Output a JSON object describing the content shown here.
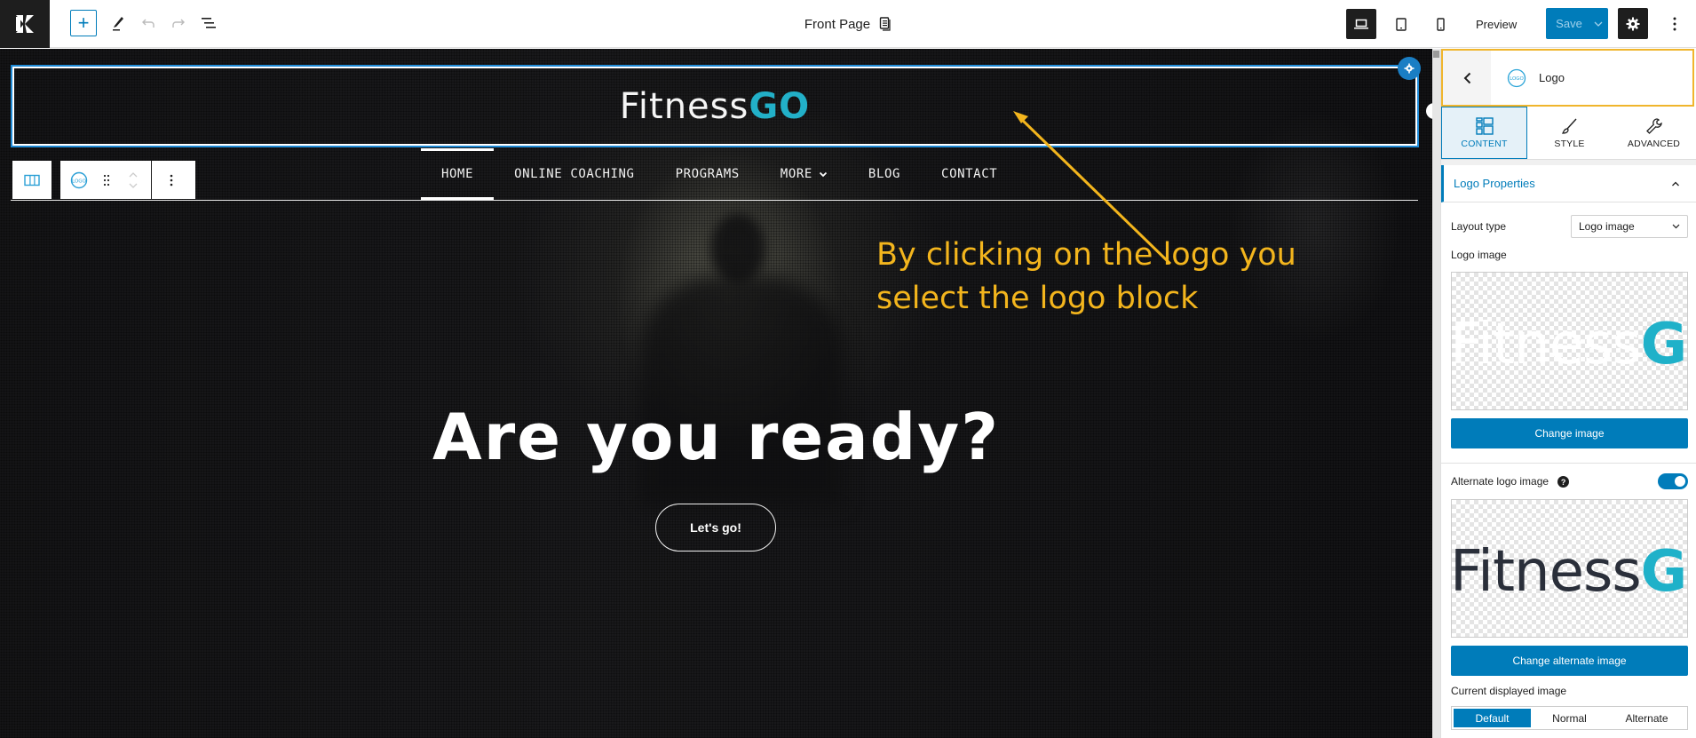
{
  "topbar": {
    "document_title": "Front Page",
    "preview_label": "Preview",
    "save_label": "Save",
    "icons": {
      "site": "kadence-logo-icon",
      "inserter": "plus-icon",
      "tools": "pencil-icon",
      "undo": "undo-icon",
      "redo": "redo-icon",
      "list_view": "list-view-icon",
      "document": "document-icon",
      "desktop": "desktop-icon",
      "tablet": "tablet-icon",
      "mobile": "mobile-icon",
      "settings": "gear-icon",
      "options": "more-vertical-icon"
    },
    "inserter_symbol": "+",
    "active_device": "desktop"
  },
  "canvas": {
    "logo": {
      "text_main": "Fitness",
      "text_accent": "GO"
    },
    "nav": [
      {
        "label": "HOME",
        "active": true
      },
      {
        "label": "ONLINE COACHING",
        "active": false
      },
      {
        "label": "PROGRAMS",
        "active": false
      },
      {
        "label": "MORE",
        "active": false,
        "has_submenu": true
      },
      {
        "label": "BLOG",
        "active": false
      },
      {
        "label": "CONTACT",
        "active": false
      }
    ],
    "hero_title": "Are you ready?",
    "hero_button": "Let's go!",
    "annotation": {
      "line1": "By clicking on the logo you",
      "line2": "select the logo block",
      "color": "#f3b51d"
    },
    "block_toolbar": {
      "parent_icon": "row-layout-icon",
      "block_icon": "logo-icon",
      "block_icon_text": "LOGO",
      "drag_icon": "drag-handle-icon",
      "move_icon": "move-up-down-icon",
      "options_icon": "more-vertical-icon"
    }
  },
  "sidebar": {
    "block_name": "Logo",
    "block_icon_text": "LOGO",
    "tabs": [
      {
        "label": "CONTENT",
        "icon": "content-layout-icon",
        "active": true
      },
      {
        "label": "STYLE",
        "icon": "brush-icon",
        "active": false
      },
      {
        "label": "ADVANCED",
        "icon": "wrench-icon",
        "active": false
      }
    ],
    "section_title": "Logo Properties",
    "layout_type_label": "Layout type",
    "layout_type_value": "Logo image",
    "logo_image_label": "Logo image",
    "logo_image_text_main": "Fitness",
    "logo_image_text_accent": "GO",
    "change_image_label": "Change image",
    "alternate_label": "Alternate logo image",
    "alternate_help": "?",
    "alternate_enabled": true,
    "change_alternate_label": "Change alternate image",
    "current_displayed_label": "Current displayed image",
    "displayed_options": [
      {
        "label": "Default",
        "active": true
      },
      {
        "label": "Normal",
        "active": false
      },
      {
        "label": "Alternate",
        "active": false
      }
    ]
  },
  "colors": {
    "accent": "#007cba",
    "selection_outline": "#1e8ad6",
    "logo_accent": "#22b0c8",
    "annotation": "#f3b51d",
    "highlight_border": "#f0b52c"
  }
}
